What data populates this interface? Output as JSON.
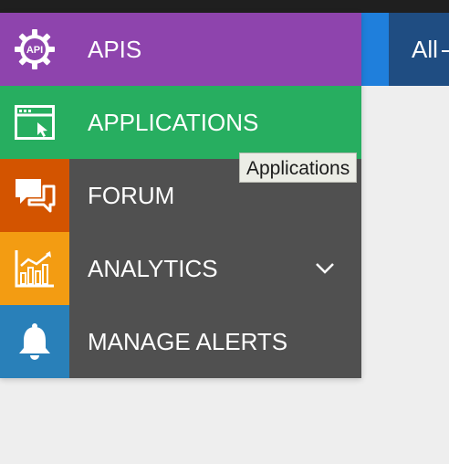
{
  "header": {
    "tab_text": "All"
  },
  "menu": {
    "items": [
      {
        "label": "APIS",
        "icon": "api-gear-icon",
        "color": "#8e44ad"
      },
      {
        "label": "APPLICATIONS",
        "icon": "browser-window-icon",
        "color": "#27ae60"
      },
      {
        "label": "FORUM",
        "icon": "chat-bubbles-icon",
        "color": "#d35400"
      },
      {
        "label": "ANALYTICS",
        "icon": "bar-chart-icon",
        "color": "#f39c12",
        "expandable": true
      },
      {
        "label": "MANAGE ALERTS",
        "icon": "bell-icon",
        "color": "#2980b9"
      }
    ],
    "submenu_background": "#505050"
  },
  "tooltip": {
    "text": "Applications"
  },
  "api_icon_text": "API"
}
